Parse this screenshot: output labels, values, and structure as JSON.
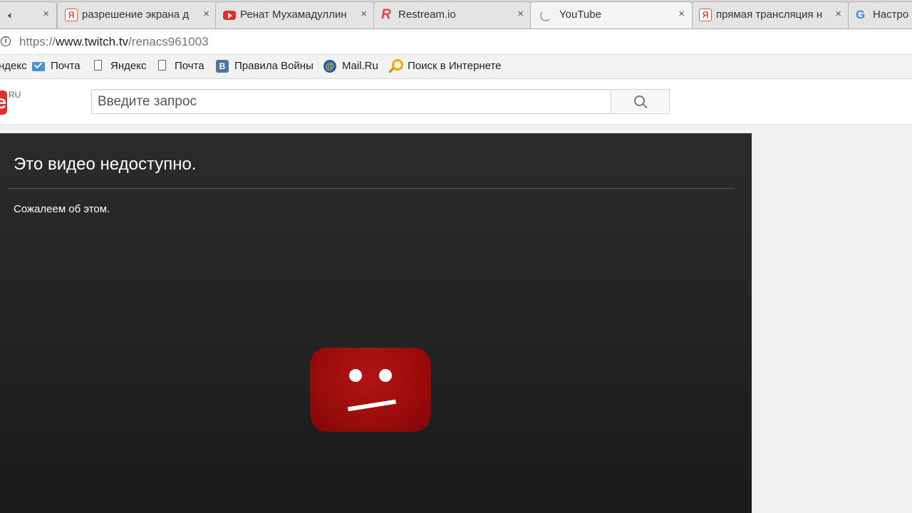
{
  "tabs": [
    {
      "title": "",
      "favicon": "speaker-icon",
      "active": false
    },
    {
      "title": "разрешение экрана д",
      "favicon": "yandex-icon",
      "active": false
    },
    {
      "title": "Ренат Мухамадуллин",
      "favicon": "youtube-icon",
      "active": false
    },
    {
      "title": "Restream.io",
      "favicon": "restream-icon",
      "active": false
    },
    {
      "title": "YouTube",
      "favicon": "loading-spinner-icon",
      "active": true
    },
    {
      "title": "прямая трансляция н",
      "favicon": "yandex-icon",
      "active": false
    },
    {
      "title": "Настро",
      "favicon": "google-icon",
      "active": false
    }
  ],
  "tab_close_glyph": "×",
  "address": {
    "scheme": "https://",
    "host": "www.twitch.tv",
    "path": "/renacs961003"
  },
  "bookmarks": [
    {
      "label": "ндекс",
      "icon": "none"
    },
    {
      "label": "Почта",
      "icon": "mail-icon"
    },
    {
      "label": "Яндекс",
      "icon": "page-icon"
    },
    {
      "label": "Почта",
      "icon": "page-icon"
    },
    {
      "label": "Правила Войны",
      "icon": "vk-icon"
    },
    {
      "label": "Mail.Ru",
      "icon": "mailru-icon"
    },
    {
      "label": "Поиск в Интернете",
      "icon": "search-globe-icon"
    }
  ],
  "youtube": {
    "logo_letter": "e",
    "logo_suffix": "RU",
    "search_placeholder": "Введите запрос",
    "search_button_icon": "magnifier-icon"
  },
  "player": {
    "error_title": "Это видео недоступно.",
    "error_subtitle": "Сожалеем об этом.",
    "error_icon": "sad-youtube-icon"
  },
  "colors": {
    "youtube_red": "#e52d27",
    "player_bg": "#2b2b2b",
    "sad_logo_red": "#b41414"
  }
}
